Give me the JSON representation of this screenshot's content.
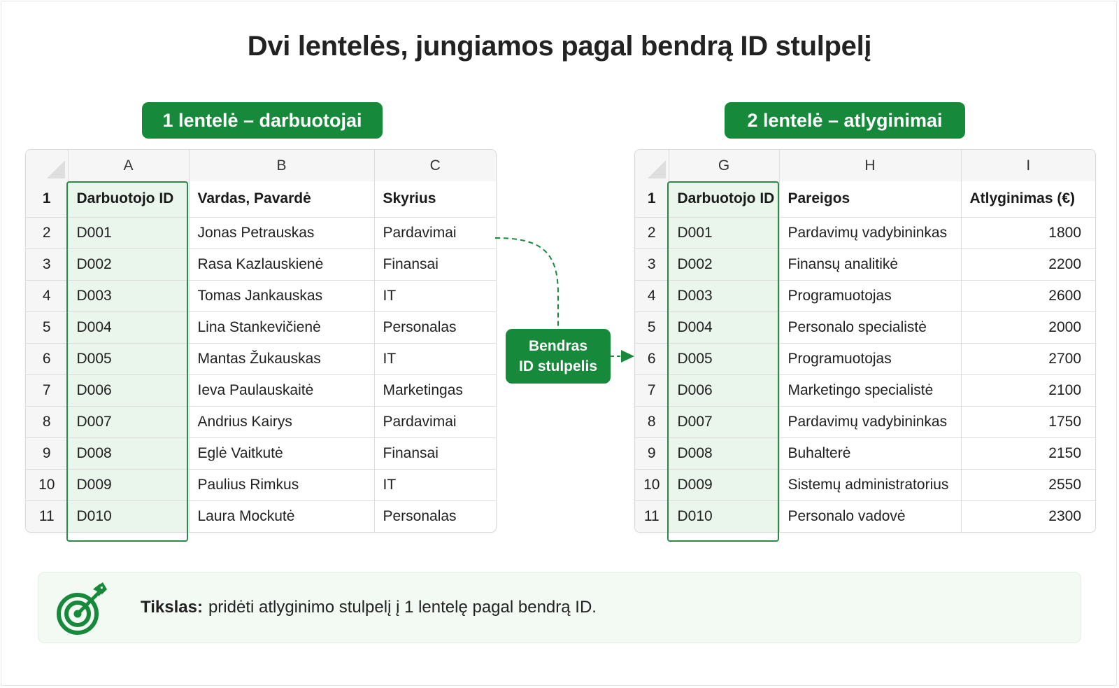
{
  "title": "Dvi lentelės, jungiamos pagal bendrą ID stulpelį",
  "colors": {
    "accent": "#168a3a",
    "id_column_fill": "#eaf5ec",
    "header_fill": "#f6f6f6"
  },
  "table1": {
    "badge": "1 lentelė – darbuotojai",
    "column_letters": [
      "A",
      "B",
      "C"
    ],
    "headers": [
      "Darbuotojo ID",
      "Vardas, Pavardė",
      "Skyrius"
    ],
    "rows": [
      [
        "D001",
        "Jonas Petrauskas",
        "Pardavimai"
      ],
      [
        "D002",
        "Rasa Kazlauskienė",
        "Finansai"
      ],
      [
        "D003",
        "Tomas Jankauskas",
        "IT"
      ],
      [
        "D004",
        "Lina Stankevičienė",
        "Personalas"
      ],
      [
        "D005",
        "Mantas Žukauskas",
        "IT"
      ],
      [
        "D006",
        "Ieva Paulauskaitė",
        "Marketingas"
      ],
      [
        "D007",
        "Andrius Kairys",
        "Pardavimai"
      ],
      [
        "D008",
        "Eglė Vaitkutė",
        "Finansai"
      ],
      [
        "D009",
        "Paulius Rimkus",
        "IT"
      ],
      [
        "D010",
        "Laura Mockutė",
        "Personalas"
      ]
    ]
  },
  "table2": {
    "badge": "2 lentelė – atlyginimai",
    "column_letters": [
      "G",
      "H",
      "I"
    ],
    "headers": [
      "Darbuotojo ID",
      "Pareigos",
      "Atlyginimas (€)"
    ],
    "rows": [
      [
        "D001",
        "Pardavimų vadybininkas",
        "1800"
      ],
      [
        "D002",
        "Finansų analitikė",
        "2200"
      ],
      [
        "D003",
        "Programuotojas",
        "2600"
      ],
      [
        "D004",
        "Personalo specialistė",
        "2000"
      ],
      [
        "D005",
        "Programuotojas",
        "2700"
      ],
      [
        "D006",
        "Marketingo specialistė",
        "2100"
      ],
      [
        "D007",
        "Pardavimų vadybininkas",
        "1750"
      ],
      [
        "D008",
        "Buhalterė",
        "2150"
      ],
      [
        "D009",
        "Sistemų administratorius",
        "2550"
      ],
      [
        "D010",
        "Personalo vadovė",
        "2300"
      ]
    ]
  },
  "row_numbers": [
    "1",
    "2",
    "3",
    "4",
    "5",
    "6",
    "7",
    "8",
    "9",
    "10",
    "11"
  ],
  "join_label": {
    "line1": "Bendras",
    "line2": "ID stulpelis"
  },
  "goal": {
    "icon": "target-arrow-icon",
    "label": "Tikslas:",
    "text": "pridėti atlyginimo stulpelį į 1 lentelę pagal bendrą ID."
  }
}
